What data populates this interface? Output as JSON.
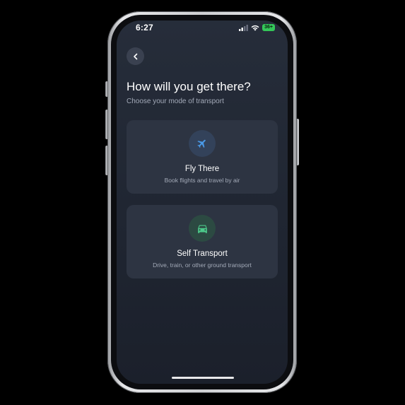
{
  "status_bar": {
    "time": "6:27",
    "battery": "36+"
  },
  "header": {
    "back_icon": "chevron-left-icon",
    "title": "How will you get there?",
    "subtitle": "Choose your mode of transport"
  },
  "options": [
    {
      "title": "Fly There",
      "description": "Book flights and travel by air",
      "icon": "airplane-icon",
      "icon_color": "#4a9ae8"
    },
    {
      "title": "Self Transport",
      "description": "Drive, train, or other ground transport",
      "icon": "car-icon",
      "icon_color": "#4cc98a"
    }
  ],
  "colors": {
    "background": "#262d3a",
    "card": "#2d3442",
    "accent_blue": "#4a9ae8",
    "accent_green": "#4cc98a",
    "battery_green": "#34c759"
  }
}
